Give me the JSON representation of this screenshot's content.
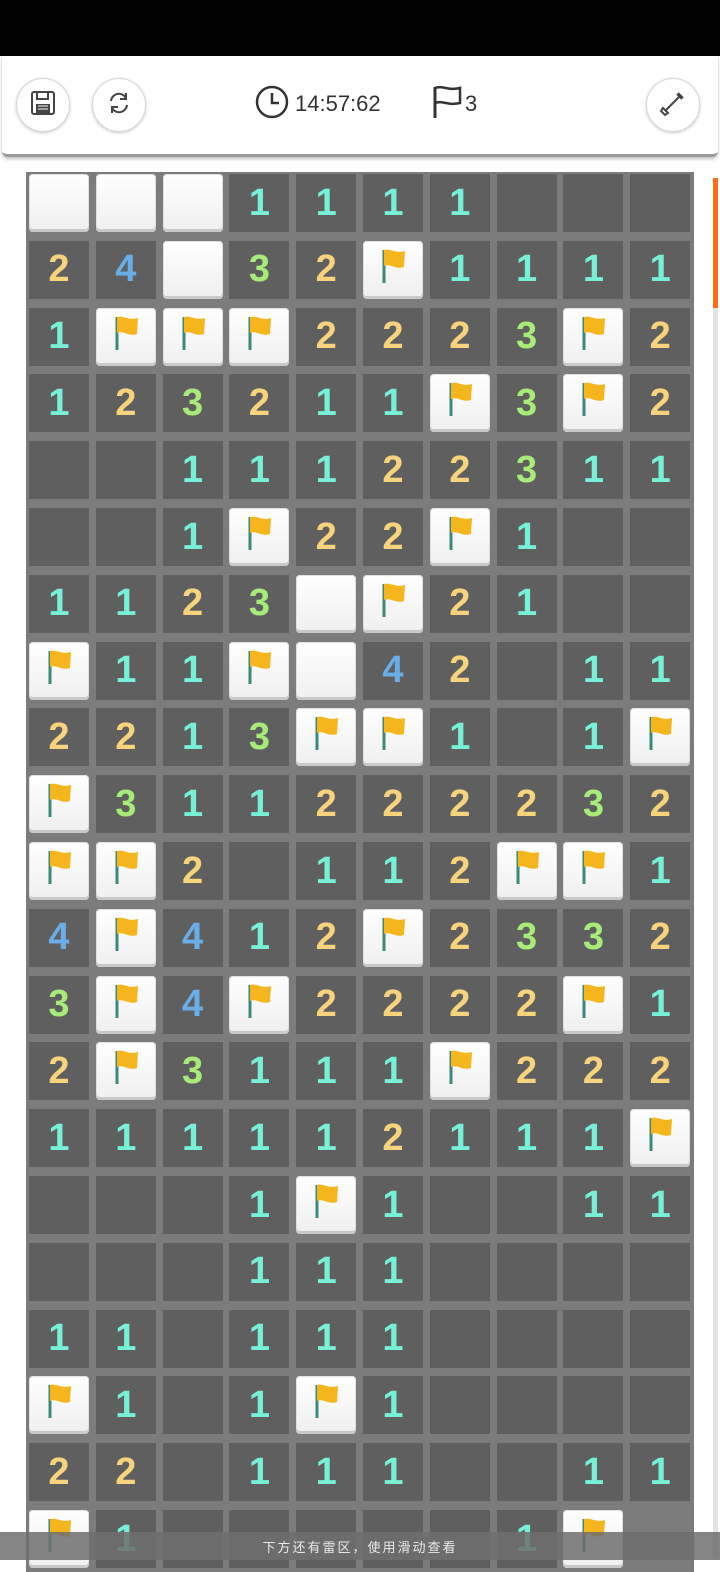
{
  "toolbar": {
    "timer": "14:57:62",
    "flag_count": "3",
    "buttons": [
      {
        "name": "save-button",
        "icon": "floppy-disk-icon"
      },
      {
        "name": "restart-button",
        "icon": "refresh-icon"
      },
      {
        "name": "dig-mode-button",
        "icon": "shovel-icon"
      }
    ]
  },
  "colors": {
    "1": "#77f0d8",
    "2": "#f7d47c",
    "3": "#a7ec78",
    "4": "#69aee8",
    "flag": "#f5b51c",
    "pole": "#3a8a7a",
    "scroll_accent": "#ff6d1a"
  },
  "board": {
    "columns": 10,
    "legend": "H = unopened tile, F = flagged tile, 0 = opened empty, digit = adjacent mine count",
    "rows": [
      "HHH11110 0 0",
      "24H32F1111",
      "1FFF222 3F2",
      "123211F3F2",
      "0011122311",
      "001F22F100",
      "1123HF2100",
      "F11FH42011",
      "2213FF101F",
      "F311222232",
      "FF20112FF1",
      "4F412F2332",
      "3F4F2222F1",
      "2F3111F222",
      "111112111F",
      "0001F10011",
      "0001110000",
      "1101110000",
      "F101F10000",
      "2201110011",
      "F100000 1F"
    ]
  },
  "footer": {
    "hint": "下方还有雷区，使用滑动查看"
  }
}
